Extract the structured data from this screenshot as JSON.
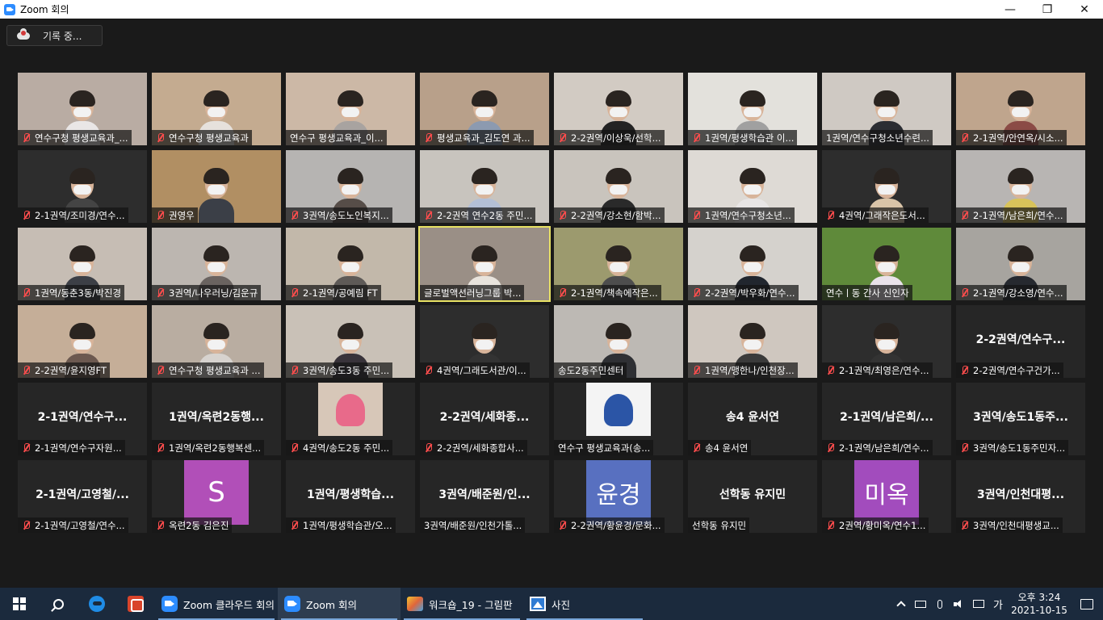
{
  "window": {
    "title": "Zoom 회의",
    "minimize": "—",
    "restore": "❐",
    "close": "✕"
  },
  "recording": {
    "label": "기록 중..."
  },
  "grid": {
    "columns": 8,
    "tiles": [
      {
        "kind": "video",
        "name": "연수구청 평생교육과_...",
        "muted": true,
        "bg": "#b9aca3",
        "shirt": "#e9e6e6"
      },
      {
        "kind": "video",
        "name": "연수구청 평생교육과",
        "muted": true,
        "bg": "#c4ab90",
        "shirt": "#e6e1dc"
      },
      {
        "kind": "video",
        "name": "연수구 평생교육과_이...",
        "muted": false,
        "bg": "#ccb8a6",
        "shirt": "#a8a3a0"
      },
      {
        "kind": "video",
        "name": "평생교육과_김도연 과...",
        "muted": true,
        "bg": "#b8a08a",
        "shirt": "#8c9ab0"
      },
      {
        "kind": "video",
        "name": "2-2권역/이상욱/선학...",
        "muted": true,
        "bg": "#d2cbc3",
        "shirt": "#232323"
      },
      {
        "kind": "video",
        "name": "1권역/평생학습관 이...",
        "muted": true,
        "bg": "#e3e1dc",
        "shirt": "#a0a0a0"
      },
      {
        "kind": "video",
        "name": "1권역/연수구청소년수련...",
        "muted": false,
        "bg": "#cfc9c3",
        "shirt": "#2b2d33"
      },
      {
        "kind": "video",
        "name": "2-1권역/안연옥/시소...",
        "muted": true,
        "bg": "#bfa58d",
        "shirt": "#8b4b46"
      },
      {
        "kind": "video",
        "name": "2-1권역/조미경/연수...",
        "muted": true,
        "bg": "#2d2d2d",
        "shirt": "#444"
      },
      {
        "kind": "video",
        "name": "권영우",
        "muted": true,
        "bg": "#b18f63",
        "shirt": "#3b3f47"
      },
      {
        "kind": "video",
        "name": "3권역/송도노인복지...",
        "muted": true,
        "bg": "#b6b4b2",
        "shirt": "#564d48"
      },
      {
        "kind": "video",
        "name": "2-2권역 연수2동 주민...",
        "muted": true,
        "bg": "#c8c4be",
        "shirt": "#b3bfd6"
      },
      {
        "kind": "video",
        "name": "2-2권역/강소현/함박...",
        "muted": true,
        "bg": "#c9c4bd",
        "shirt": "#2a2a2a"
      },
      {
        "kind": "video",
        "name": "1권역/연수구청소년...",
        "muted": true,
        "bg": "#dedad5",
        "shirt": "#e8e5e5"
      },
      {
        "kind": "video",
        "name": "4권역/그래작은도서...",
        "muted": true,
        "bg": "#2d2d2d",
        "shirt": "#d9c4a8"
      },
      {
        "kind": "video",
        "name": "2-1권역/남은희/연수...",
        "muted": true,
        "bg": "#b8b5b3",
        "shirt": "#d8c35a"
      },
      {
        "kind": "video",
        "name": "1권역/동춘3동/박진경",
        "muted": true,
        "bg": "#c6bdb4",
        "shirt": "#3c3f46"
      },
      {
        "kind": "video",
        "name": "3권역/나우러닝/김운규",
        "muted": true,
        "bg": "#bcb6b0",
        "shirt": "#6a6360"
      },
      {
        "kind": "video",
        "name": "2-1권역/공예림 FT",
        "muted": true,
        "bg": "#c2b8aa",
        "shirt": "#5e5a57"
      },
      {
        "kind": "video",
        "name": "글로벌액션러닝그룹 박...",
        "muted": false,
        "bg": "#9a8f86",
        "shirt": "#e8e3dc",
        "active": true
      },
      {
        "kind": "video",
        "name": "2-1권역/책속에작은...",
        "muted": true,
        "bg": "#9c9a6e",
        "shirt": "#4d4d4d"
      },
      {
        "kind": "video",
        "name": "2-2권역/박우화/연수...",
        "muted": true,
        "bg": "#d5d2cd",
        "shirt": "#21262e"
      },
      {
        "kind": "video",
        "name": "연수ㅣ동 간사 신인자",
        "muted": false,
        "bg": "#5f8a3a",
        "shirt": "#e9e2ea"
      },
      {
        "kind": "video",
        "name": "2-1권역/강소영/연수...",
        "muted": true,
        "bg": "#a7a49f",
        "shirt": "#26292f"
      },
      {
        "kind": "video",
        "name": "2-2권역/윤지영FT",
        "muted": true,
        "bg": "#c5ae98",
        "shirt": "#6c5950"
      },
      {
        "kind": "video",
        "name": "연수구청 평생교육과 ...",
        "muted": true,
        "bg": "#b9ada1",
        "shirt": "#d7d3cf"
      },
      {
        "kind": "video",
        "name": "3권역/송도3동 주민...",
        "muted": true,
        "bg": "#c9c1b7",
        "shirt": "#38333a"
      },
      {
        "kind": "video",
        "name": "4권역/그래도서관/이...",
        "muted": true,
        "bg": "#2d2d2d",
        "shirt": "#333"
      },
      {
        "kind": "video",
        "name": "송도2동주민센터",
        "muted": false,
        "bg": "#bdb9b4",
        "shirt": "#2f3034"
      },
      {
        "kind": "video",
        "name": "1권역/맹한나/인천장...",
        "muted": true,
        "bg": "#cfc7bf",
        "shirt": "#3a3a3a"
      },
      {
        "kind": "video",
        "name": "2-1권역/최영은/연수...",
        "muted": true,
        "bg": "#2d2d2d",
        "shirt": "#333"
      },
      {
        "kind": "text",
        "big": "2-2권역/연수구...",
        "name": "2-2권역/연수구건가...",
        "muted": true
      },
      {
        "kind": "text",
        "big": "2-1권역/연수구...",
        "name": "2-1권역/연수구자원...",
        "muted": true
      },
      {
        "kind": "text",
        "big": "1권역/옥련2동행...",
        "name": "1권역/옥련2동행복센...",
        "muted": true
      },
      {
        "kind": "image",
        "name": "4권역/송도2동 주민...",
        "muted": true,
        "bg": "#d7c7b8",
        "accent": "#e86a8a"
      },
      {
        "kind": "text",
        "big": "2-2권역/세화종...",
        "name": "2-2권역/세화종합사...",
        "muted": true
      },
      {
        "kind": "image",
        "name": "연수구 평생교육과(송...",
        "muted": false,
        "bg": "#f4f4f4",
        "accent": "#2b55a6"
      },
      {
        "kind": "text",
        "big": "송4 윤서연",
        "name": "송4 윤서연",
        "muted": true
      },
      {
        "kind": "text",
        "big": "2-1권역/남은희/...",
        "name": "2-1권역/남은희/연수...",
        "muted": true
      },
      {
        "kind": "text",
        "big": "3권역/송도1동주...",
        "name": "3권역/송도1동주민자...",
        "muted": true
      },
      {
        "kind": "text",
        "big": "2-1권역/고영철/...",
        "name": "2-1권역/고영철/연수...",
        "muted": true
      },
      {
        "kind": "avatar",
        "letter": "S",
        "color": "#b14fb8",
        "name": "옥련2동 김은진",
        "muted": true
      },
      {
        "kind": "text",
        "big": "1권역/평생학습...",
        "name": "1권역/평생학습관/오...",
        "muted": true
      },
      {
        "kind": "text",
        "big": "3권역/배준원/인...",
        "name": "3권역/배준원/인천가톨...",
        "muted": false
      },
      {
        "kind": "avatar",
        "letter": "윤경",
        "color": "#5870c0",
        "name": "2-2권역/황윤경/문화...",
        "muted": true
      },
      {
        "kind": "text",
        "big": "선학동 유지민",
        "name": "선학동 유지민",
        "muted": false
      },
      {
        "kind": "avatar",
        "letter": "미옥",
        "color": "#a24cbd",
        "name": "2권역/황미옥/연수1...",
        "muted": true
      },
      {
        "kind": "text",
        "big": "3권역/인천대평...",
        "name": "3권역/인천대평생교...",
        "muted": true
      }
    ]
  },
  "taskbar": {
    "items": [
      {
        "label": "Zoom 클라우드 회의",
        "icon": "zoom-icon",
        "active": false
      },
      {
        "label": "Zoom 회의",
        "icon": "zoom-icon",
        "active": true
      },
      {
        "label": "워크숍_19 - 그림판",
        "icon": "paint-icon",
        "active": false
      },
      {
        "label": "사진",
        "icon": "photos-icon",
        "active": false
      }
    ],
    "ime": "가",
    "time": "오후 3:24",
    "date": "2021-10-15"
  }
}
